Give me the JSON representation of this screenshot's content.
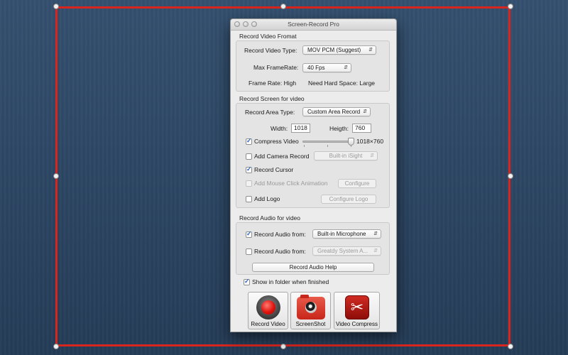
{
  "window": {
    "title": "Screen-Record Pro"
  },
  "video_format": {
    "section_title": "Record Video Fromat",
    "video_type_label": "Record Video Type:",
    "video_type_value": "MOV PCM (Suggest)",
    "framerate_label": "Max FrameRate:",
    "framerate_value": "40 Fps",
    "frame_rate_info": "Frame Rate: High",
    "hard_space_info": "Need Hard Space: Large"
  },
  "screen": {
    "section_title": "Record Screen for video",
    "area_type_label": "Record Area Type:",
    "area_type_value": "Custom Area Record",
    "width_label": "Width:",
    "width_value": "1018",
    "height_label": "Heigth:",
    "height_value": "760",
    "compress_label": "Compress Video",
    "compress_checked": true,
    "compress_size": "1018×760",
    "camera_label": "Add Camera Record",
    "camera_checked": false,
    "camera_source": "Built-in iSight",
    "cursor_label": "Record Cursor",
    "cursor_checked": true,
    "mouse_anim_label": "Add Mouse Click Animation",
    "mouse_anim_checked": false,
    "configure_label": "Configure",
    "logo_label": "Add Logo",
    "logo_checked": false,
    "configure_logo_label": "Configure Logo"
  },
  "audio": {
    "section_title": "Record Audio for video",
    "mic_label": "Record Audio from:",
    "mic_checked": true,
    "mic_source": "Built-in Microphone",
    "system_label": "Record Audio from:",
    "system_checked": false,
    "system_source": "Greatdy System A...",
    "help_label": "Record Audio Help"
  },
  "show_in_folder": {
    "label": "Show in folder when finished",
    "checked": true
  },
  "actions": {
    "record_video": "Record Video",
    "screenshot": "ScreenShot",
    "video_compress": "Video Compress"
  },
  "colors": {
    "selection_frame": "#d8261f",
    "checkbox_accent": "#2a64c6",
    "record_red": "#e0130d"
  }
}
